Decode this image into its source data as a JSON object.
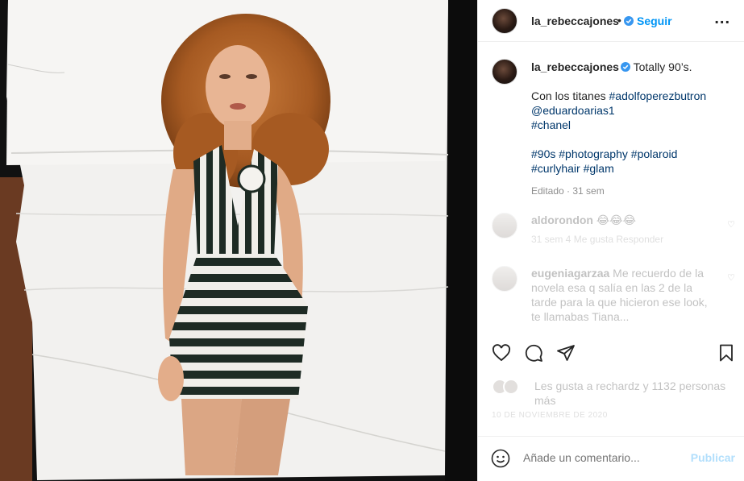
{
  "header": {
    "username": "la_rebeccajones",
    "dot": "•",
    "follow_label": "Seguir",
    "more_label": "..."
  },
  "caption": {
    "username": "la_rebeccajones",
    "text_first": "Totally 90’s.",
    "text_second": "Con los titanes",
    "tags": [
      "#adolfoperezbutron",
      "@eduardoarias1",
      "#chanel"
    ],
    "tags_line3": [
      "#90s",
      "#photography",
      "#polaroid"
    ],
    "tags_line4": [
      "#curlyhair",
      "#glam"
    ],
    "meta": "Editado · 31 sem"
  },
  "comments": [
    {
      "username": "aldorondon",
      "text": "😂😂😂",
      "meta": "31 sem   4 Me gusta   Responder"
    },
    {
      "username": "eugeniagarzaa",
      "text": "Me recuerdo de la novela esa q salía en las 2 de la tarde para la que hicieron ese look, te llamabas Tiana..."
    }
  ],
  "likes": {
    "text": "Les gusta a rechardz y 1132 personas más",
    "date": "10 DE NOVIEMBRE DE 2020"
  },
  "add_comment": {
    "placeholder": "Añade un comentario...",
    "publish_label": "Publicar"
  },
  "icons": {
    "verified": "verified-badge-icon",
    "like": "heart-icon",
    "comment": "comment-bubble-icon",
    "share": "paper-plane-icon",
    "save": "bookmark-icon",
    "emoji": "smiley-icon"
  },
  "colors": {
    "accent": "#0095f6",
    "hashtag": "#00376b",
    "muted": "#8e8e8e"
  }
}
